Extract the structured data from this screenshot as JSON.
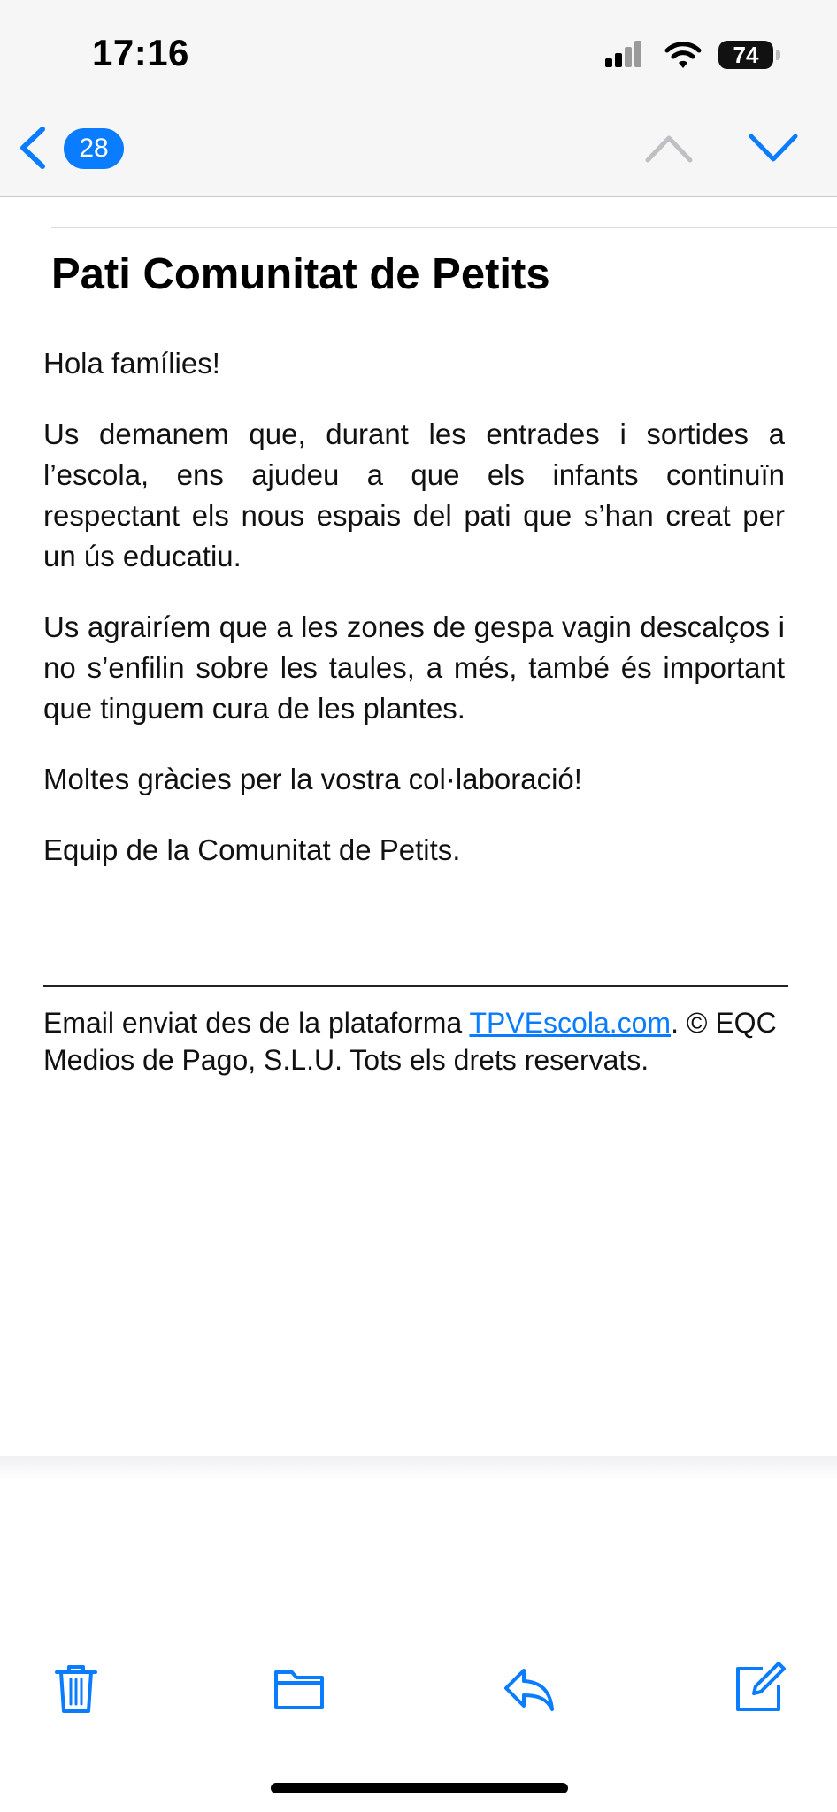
{
  "status_bar": {
    "time": "17:16",
    "battery": "74",
    "icons": [
      "signal-icon",
      "wifi-icon",
      "battery-icon"
    ]
  },
  "nav": {
    "unread_count": "28",
    "icons": [
      "chevron-left-icon",
      "chevron-up-icon",
      "chevron-down-icon"
    ],
    "accent_color": "#0a7cff",
    "disabled_color": "#bfbfc4"
  },
  "email": {
    "subject": "Pati Comunitat de Petits",
    "paragraphs": [
      "Hola famílies!",
      "Us demanem que, durant les entrades i sortides a l’escola, ens ajudeu a que els infants continuïn respectant els nous espais del pati que s’han creat per un ús educatiu.",
      "Us agrairíem que a les zones de gespa vagin descalços i no s’enfilin sobre les taules, a més, també és important que tinguem cura de les plantes.",
      "Moltes gràcies per la vostra col·laboració!",
      "Equip de la Comunitat de Petits."
    ],
    "footer": {
      "prefix": "Email enviat des de la plataforma ",
      "link": "TPVEscola.com",
      "suffix": ". © EQC Medios de Pago, S.L.U. Tots els drets reservats."
    }
  },
  "toolbar": {
    "icons": [
      "trash-icon",
      "folder-icon",
      "reply-icon",
      "compose-icon"
    ]
  }
}
